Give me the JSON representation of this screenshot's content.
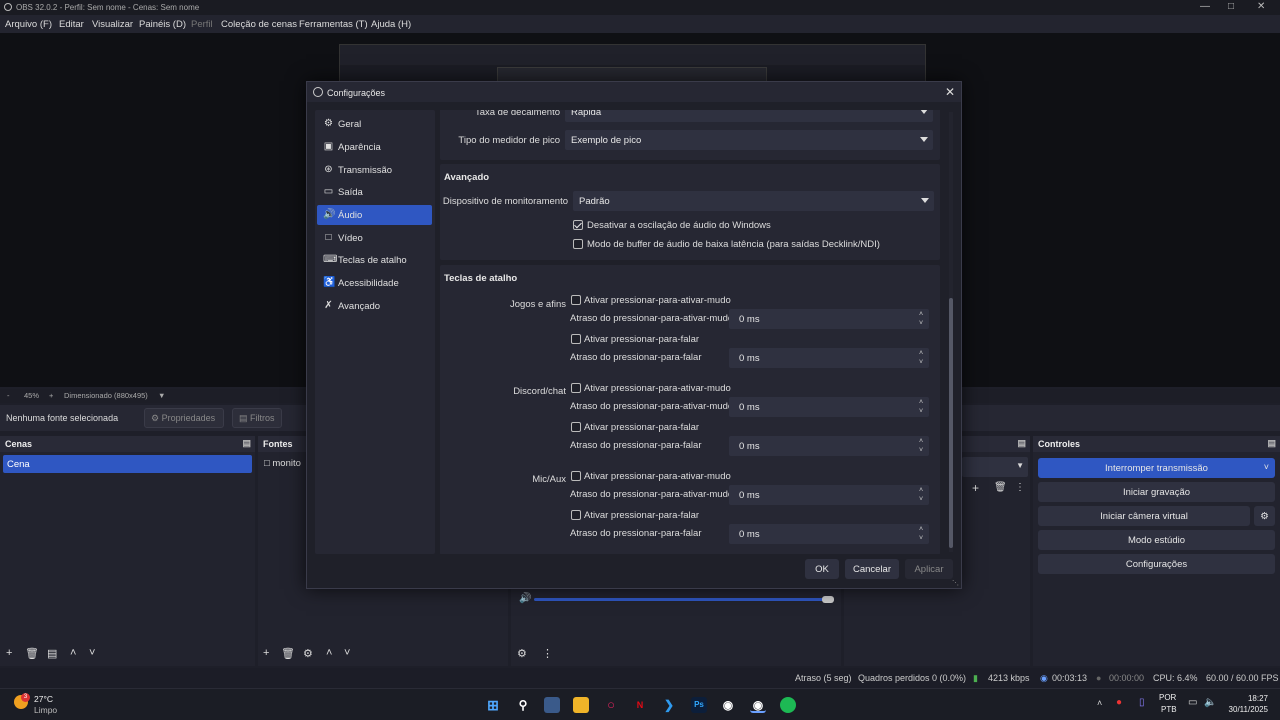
{
  "window": {
    "title": "OBS 32.0.2 - Perfil: Sem nome - Cenas: Sem nome"
  },
  "menu": [
    "Arquivo (F)",
    "Editar",
    "Visualizar",
    "Painéis (D)",
    "Perfil",
    "Coleção de cenas",
    "Ferramentas (T)",
    "Ajuda (H)"
  ],
  "preview": {
    "zoom": "45%",
    "canvas": "Dimensionado (880x495)",
    "minus": "-",
    "plus": "+"
  },
  "source_bar": {
    "label": "Nenhuma fonte selecionada",
    "properties": "Propriedades",
    "filters": "Filtros"
  },
  "docks": {
    "scenes": {
      "title": "Cenas",
      "items": [
        "Cena"
      ]
    },
    "sources": {
      "title": "Fontes",
      "items": [
        "monito"
      ]
    },
    "controls": {
      "title": "Controles",
      "buttons": [
        "Interromper transmissão",
        "Iniciar gravação",
        "Iniciar câmera virtual",
        "Modo estúdio",
        "Configurações"
      ]
    }
  },
  "status": {
    "delay": "Atraso (5 seg)",
    "dropped": "Quadros perdidos 0 (0.0%)",
    "bitrate": "4213 kbps",
    "stream_time": "00:03:13",
    "rec_time": "00:00:00",
    "cpu": "CPU: 6.4%",
    "fps": "60.00 / 60.00 FPS"
  },
  "taskbar": {
    "weather_temp": "27°C",
    "weather_desc": "Limpo",
    "lang": "POR",
    "layout": "PTB",
    "time": "18:27",
    "date": "30/11/2025",
    "badge": "3",
    "ps_label": "Ps"
  },
  "dialog": {
    "title": "Configurações",
    "sidebar": [
      {
        "label": "Geral",
        "icon": "gear-icon"
      },
      {
        "label": "Aparência",
        "icon": "palette-icon"
      },
      {
        "label": "Transmissão",
        "icon": "broadcast-icon"
      },
      {
        "label": "Saída",
        "icon": "output-icon"
      },
      {
        "label": "Áudio",
        "icon": "speaker-icon"
      },
      {
        "label": "Vídeo",
        "icon": "monitor-icon"
      },
      {
        "label": "Teclas de atalho",
        "icon": "keyboard-icon"
      },
      {
        "label": "Acessibilidade",
        "icon": "accessibility-icon"
      },
      {
        "label": "Avançado",
        "icon": "wrench-icon"
      }
    ],
    "active_section": "Áudio",
    "meters": {
      "decay_label": "Taxa de decaimento",
      "decay_value": "Rápida",
      "peak_label": "Tipo do medidor de pico",
      "peak_value": "Exemplo de pico"
    },
    "advanced": {
      "title": "Avançado",
      "monitor_label": "Dispositivo de monitoramento",
      "monitor_value": "Padrão",
      "ducking_label": "Desativar a oscilação de áudio do Windows",
      "ducking_checked": true,
      "lowlatency_label": "Modo de buffer de áudio de baixa latência (para saídas Decklink/NDI)",
      "lowlatency_checked": false
    },
    "hotkeys": {
      "title": "Teclas de atalho",
      "sources": [
        {
          "name": "Jogos e afins",
          "ptm_label": "Ativar pressionar-para-ativar-mudo",
          "ptm_delay_label": "Atraso do pressionar-para-ativar-mudo",
          "ptm_delay": "0 ms",
          "ptt_label": "Ativar pressionar-para-falar",
          "ptt_delay_label": "Atraso do pressionar-para-falar",
          "ptt_delay": "0 ms"
        },
        {
          "name": "Discord/chat",
          "ptm_label": "Ativar pressionar-para-ativar-mudo",
          "ptm_delay_label": "Atraso do pressionar-para-ativar-mudo",
          "ptm_delay": "0 ms",
          "ptt_label": "Ativar pressionar-para-falar",
          "ptt_delay_label": "Atraso do pressionar-para-falar",
          "ptt_delay": "0 ms"
        },
        {
          "name": "Mic/Aux",
          "ptm_label": "Ativar pressionar-para-ativar-mudo",
          "ptm_delay_label": "Atraso do pressionar-para-ativar-mudo",
          "ptm_delay": "0 ms",
          "ptt_label": "Ativar pressionar-para-falar",
          "ptt_delay_label": "Atraso do pressionar-para-falar",
          "ptt_delay": "0 ms"
        }
      ]
    },
    "buttons": {
      "ok": "OK",
      "cancel": "Cancelar",
      "apply": "Aplicar"
    }
  },
  "colors": {
    "accent": "#2f57c2",
    "dialog_bg": "#1f2029",
    "panel_bg": "#262733"
  }
}
